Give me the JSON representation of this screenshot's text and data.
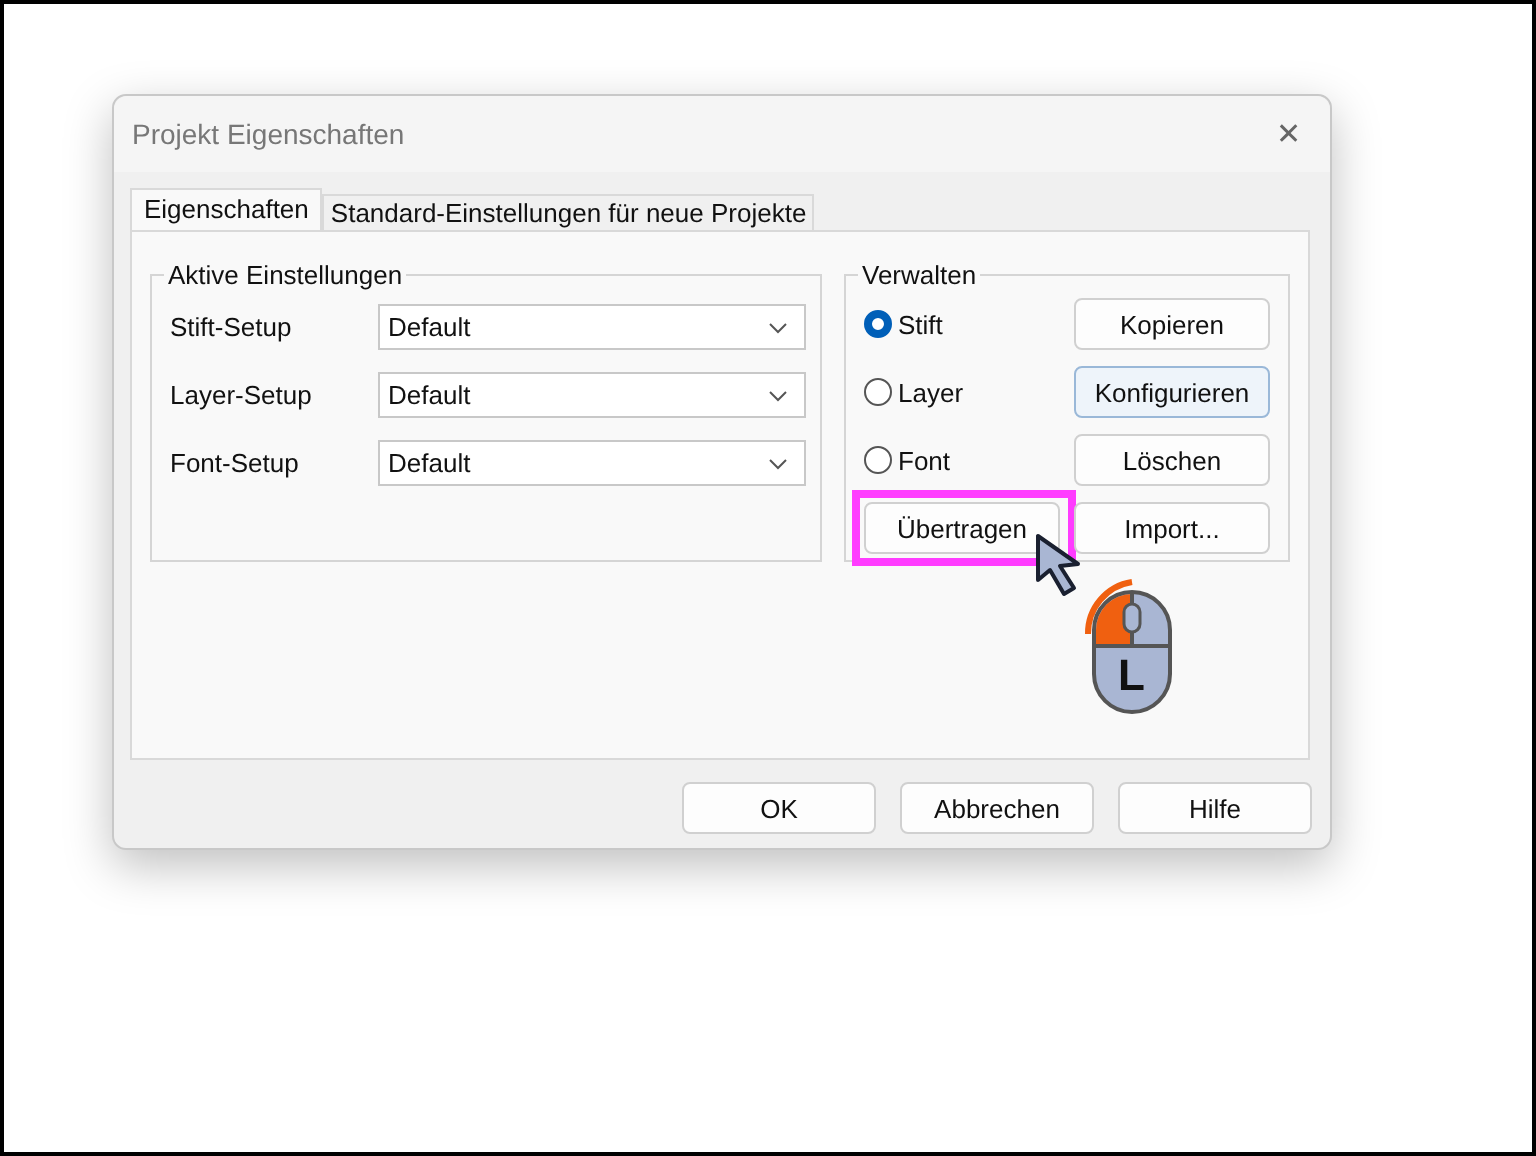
{
  "window": {
    "title": "Projekt Eigenschaften",
    "close": "✕"
  },
  "tabs": [
    {
      "label": "Eigenschaften",
      "selected": true
    },
    {
      "label": "Standard-Einstellungen für neue Projekte",
      "selected": false
    }
  ],
  "active_settings": {
    "title": "Aktive Einstellungen",
    "rows": [
      {
        "label": "Stift-Setup",
        "value": "Default"
      },
      {
        "label": "Layer-Setup",
        "value": "Default"
      },
      {
        "label": "Font-Setup",
        "value": "Default"
      }
    ]
  },
  "manage": {
    "title": "Verwalten",
    "options": [
      {
        "label": "Stift",
        "selected": true
      },
      {
        "label": "Layer",
        "selected": false
      },
      {
        "label": "Font",
        "selected": false
      }
    ],
    "buttons": [
      {
        "label": "Kopieren",
        "focused": false
      },
      {
        "label": "Konfigurieren",
        "focused": true
      },
      {
        "label": "Löschen",
        "focused": false
      },
      {
        "label": "Import...",
        "focused": false
      }
    ],
    "transfer": {
      "label": "Übertragen",
      "highlighted": true
    }
  },
  "mouse_hint": {
    "button": "L"
  },
  "buttons": [
    "OK",
    "Abbrechen",
    "Hilfe"
  ]
}
